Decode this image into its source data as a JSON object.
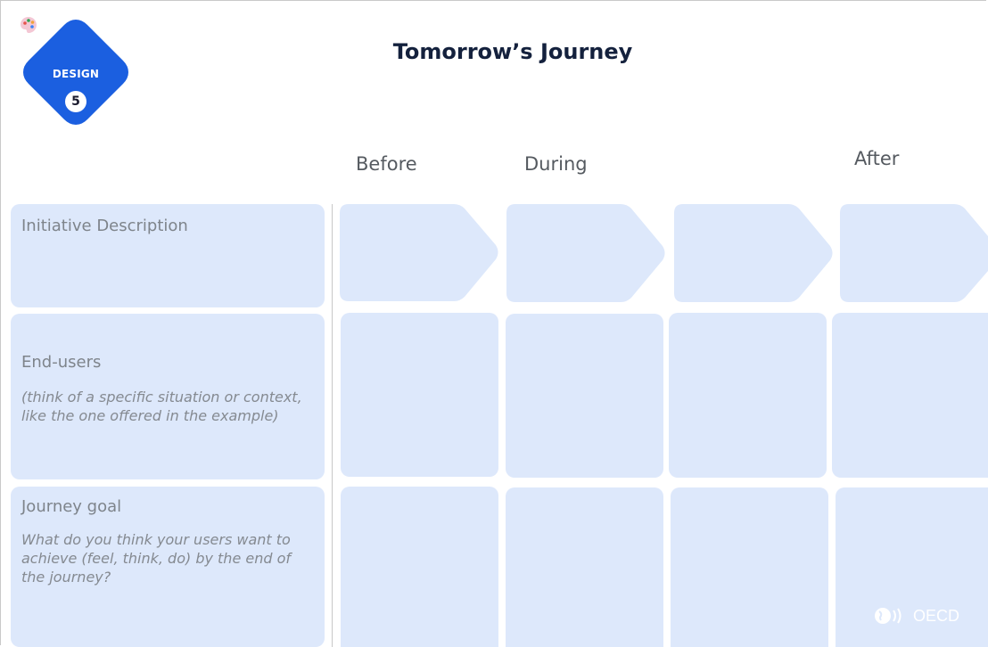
{
  "badge": {
    "label": "DESIGN",
    "number": "5",
    "icon": "palette-icon"
  },
  "title": "Tomorrow’s Journey",
  "columns": {
    "before": "Before",
    "during": "During",
    "after": "After"
  },
  "rows": {
    "initiative": {
      "label": "Initiative Description"
    },
    "endusers": {
      "label": "End-users",
      "hint": "(think of a specific situation or context, like the one offered in the example)"
    },
    "goal": {
      "label": "Journey goal",
      "hint": "What do you think your users want to achieve (feel, think, do) by the end of the journey?"
    }
  },
  "logo": {
    "text": "OECD"
  },
  "colors": {
    "badge": "#1b5fe0",
    "cell": "#dde8fb",
    "title": "#14213d"
  }
}
